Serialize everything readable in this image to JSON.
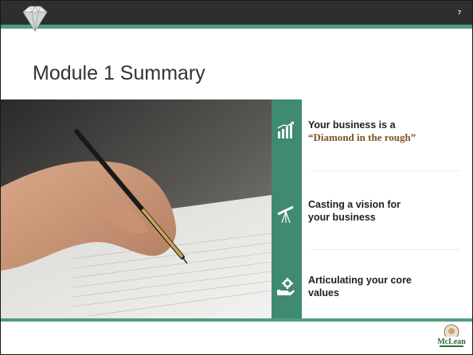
{
  "slide": {
    "number": "7",
    "title": "Module 1 Summary"
  },
  "items": [
    {
      "line1": "Your business is a",
      "highlight": "“Diamond in the rough”",
      "icon": "bar-chart-icon"
    },
    {
      "line1": "Casting a vision for",
      "line2": "your business",
      "icon": "telescope-icon"
    },
    {
      "line1": "Articulating your core",
      "line2": "values",
      "icon": "hand-gear-icon"
    }
  ],
  "logo": {
    "text": "McLean"
  },
  "colors": {
    "topbar": "#2e2e2e",
    "accent": "#4f9d81",
    "teal_column": "#3f8a72",
    "highlight": "#7a5326"
  }
}
